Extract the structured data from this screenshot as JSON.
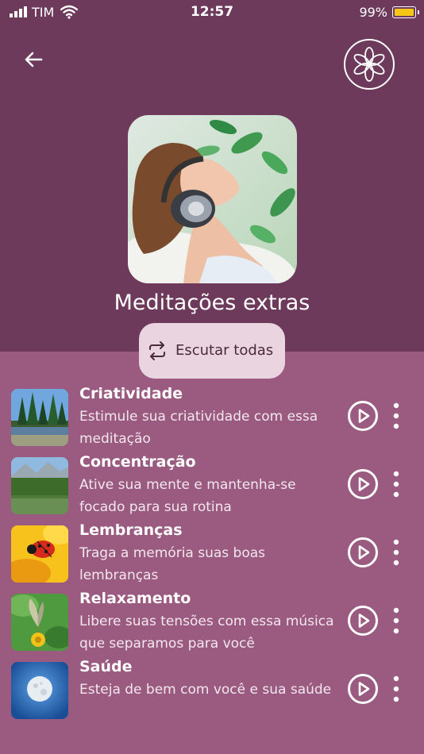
{
  "status": {
    "carrier": "TIM",
    "time": "12:57",
    "battery": "99%"
  },
  "header": {
    "back_icon": "arrow-left-icon",
    "logo_icon": "flower-logo-icon"
  },
  "playlist": {
    "title": "Meditações extras",
    "listen_all_label": "Escutar todas"
  },
  "items": [
    {
      "title": "Criatividade",
      "description": "Estimule sua criatividade com essa meditação"
    },
    {
      "title": "Concentração",
      "description": "Ative sua mente e mantenha-se focado para sua rotina"
    },
    {
      "title": "Lembranças",
      "description": "Traga a memória suas boas lembranças"
    },
    {
      "title": "Relaxamento",
      "description": "Libere suas tensões com essa música que separamos para você"
    },
    {
      "title": "Saúde",
      "description": "Esteja de bem com você e sua saúde"
    }
  ],
  "colors": {
    "header_bg": "#6d3a5c",
    "list_bg": "#9b5a80",
    "button_bg": "#ead4e0",
    "battery": "#f5c518"
  }
}
